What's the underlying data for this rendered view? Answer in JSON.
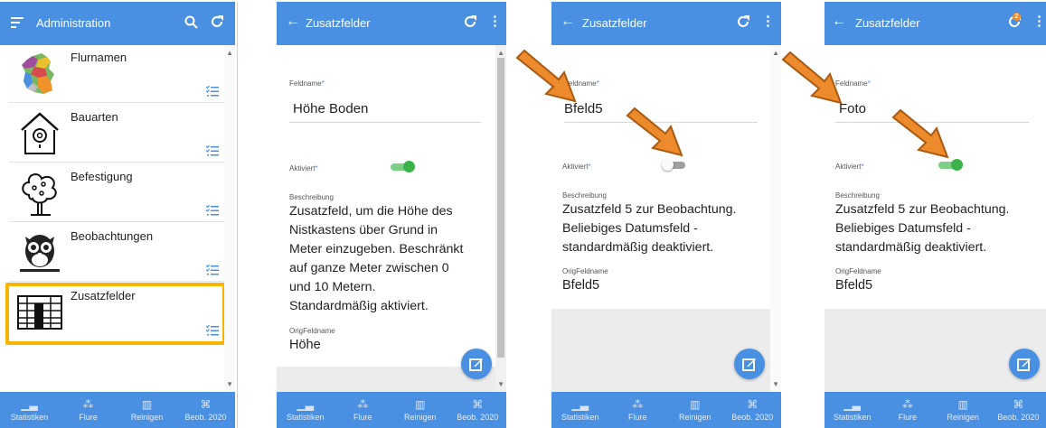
{
  "colors": {
    "primary": "#4a90e2",
    "toggle_on": "#3cb34a",
    "highlight": "#f7b500",
    "arrow": "#ec8a2c"
  },
  "nav": [
    {
      "label": "Statistiken",
      "icon": "bar-chart-icon"
    },
    {
      "label": "Flure",
      "icon": "dots-icon"
    },
    {
      "label": "Reinigen",
      "icon": "map-icon"
    },
    {
      "label": "Beob. 2020",
      "icon": "binoculars-icon"
    }
  ],
  "panel1": {
    "title": "Administration",
    "items": [
      {
        "label": "Flurnamen",
        "icon": "germany-map-icon"
      },
      {
        "label": "Bauarten",
        "icon": "birdhouse-icon"
      },
      {
        "label": "Befestigung",
        "icon": "tree-icon"
      },
      {
        "label": "Beobachtungen",
        "icon": "owl-icon"
      },
      {
        "label": "Zusatzfelder",
        "icon": "table-icon"
      }
    ]
  },
  "panel2": {
    "title": "Zusatzfelder",
    "feldname_label": "Feldname",
    "feldname_value": "Höhe Boden",
    "aktiviert_label": "Aktiviert",
    "aktiviert_on": true,
    "beschreibung_label": "Beschreibung",
    "beschreibung_lines": [
      "Zusatzfeld, um die Höhe des",
      "Nistkastens über Grund in",
      "Meter einzugeben. Beschränkt",
      "auf ganze Meter zwischen 0",
      "und 10 Metern.",
      "Standardmäßig aktiviert."
    ],
    "origfeldname_label": "OrigFeldname",
    "origfeldname_value": "Höhe"
  },
  "panel3": {
    "title": "Zusatzfelder",
    "feldname_label": "Feldname",
    "feldname_value": "Bfeld5",
    "aktiviert_label": "Aktiviert",
    "aktiviert_on": false,
    "beschreibung_label": "Beschreibung",
    "beschreibung_lines": [
      "Zusatzfeld 5 zur Beobachtung.",
      "Beliebiges Datumsfeld -",
      "standardmäßig deaktiviert."
    ],
    "origfeldname_label": "OrigFeldname",
    "origfeldname_value": "Bfeld5"
  },
  "panel4": {
    "title": "Zusatzfelder",
    "badge": "2",
    "feldname_label": "Feldname",
    "feldname_value": "Foto",
    "aktiviert_label": "Aktiviert",
    "aktiviert_on": true,
    "beschreibung_label": "Beschreibung",
    "beschreibung_lines": [
      "Zusatzfeld 5 zur Beobachtung.",
      "Beliebiges Datumsfeld -",
      "standardmäßig deaktiviert."
    ],
    "origfeldname_label": "OrigFeldname",
    "origfeldname_value": "Bfeld5"
  }
}
